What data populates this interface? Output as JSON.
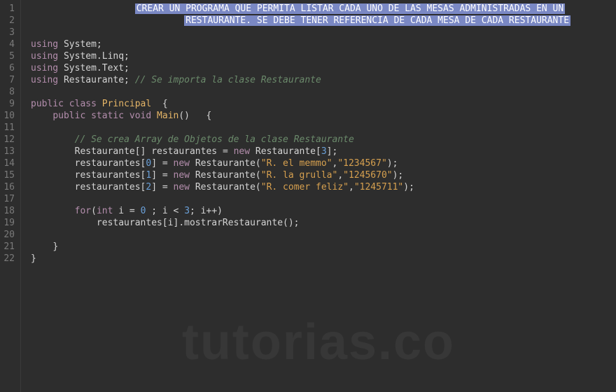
{
  "watermark": "tutorias.co",
  "gutter": [
    "1",
    "2",
    "3",
    "4",
    "5",
    "6",
    "7",
    "8",
    "9",
    "10",
    "11",
    "12",
    "13",
    "14",
    "15",
    "16",
    "17",
    "18",
    "19",
    "20",
    "21",
    "22"
  ],
  "lines": {
    "l1_sel": "CREAR UN PROGRAMA QUE PERMITA LISTAR CADA UNO DE LAS MESAS ADMINISTRADAS EN UN",
    "l2_sel": "RESTAURANTE. SE DEBE TENER REFERENCIA DE CADA MESA DE CADA RESTAURANTE",
    "l4_kw": "using",
    "l4_ns": "System;",
    "l5_kw": "using",
    "l5_ns": "System.Linq;",
    "l6_kw": "using",
    "l6_ns": "System.Text;",
    "l7_kw": "using",
    "l7_ns": "Restaurante;",
    "l7_comment": "// Se importa la clase Restaurante",
    "l9_kw1": "public",
    "l9_kw2": "class",
    "l9_cls": "Principal",
    "l9_brace": "  {",
    "l10_kw1": "public",
    "l10_kw2": "static",
    "l10_kw3": "void",
    "l10_m": "Main",
    "l10_tail": "()   {",
    "l12_comment": "// Se crea Array de Objetos de la clase Restaurante",
    "l13_a": "Restaurante[] restaurantes = ",
    "l13_kw": "new",
    "l13_b": " Restaurante[",
    "l13_n": "3",
    "l13_c": "];",
    "l14_a": "restaurantes[",
    "l14_idx": "0",
    "l14_b": "] = ",
    "l14_kw": "new",
    "l14_c": " Restaurante(",
    "l14_s1": "\"R. el memmo\"",
    "l14_d": ",",
    "l14_s2": "\"1234567\"",
    "l14_e": ");",
    "l15_a": "restaurantes[",
    "l15_idx": "1",
    "l15_b": "] = ",
    "l15_kw": "new",
    "l15_c": " Restaurante(",
    "l15_s1": "\"R. la grulla\"",
    "l15_d": ",",
    "l15_s2": "\"1245670\"",
    "l15_e": ");",
    "l16_a": "restaurantes[",
    "l16_idx": "2",
    "l16_b": "] = ",
    "l16_kw": "new",
    "l16_c": " Restaurante(",
    "l16_s1": "\"R. comer feliz\"",
    "l16_d": ",",
    "l16_s2": "\"1245711\"",
    "l16_e": ");",
    "l18_kw1": "for",
    "l18_a": "(",
    "l18_kw2": "int",
    "l18_b": " i = ",
    "l18_n0": "0",
    "l18_c": " ; i < ",
    "l18_n3": "3",
    "l18_d": "; i++)",
    "l19": "restaurantes[i].mostrarRestaurante();",
    "l21": "}",
    "l22": "}"
  }
}
